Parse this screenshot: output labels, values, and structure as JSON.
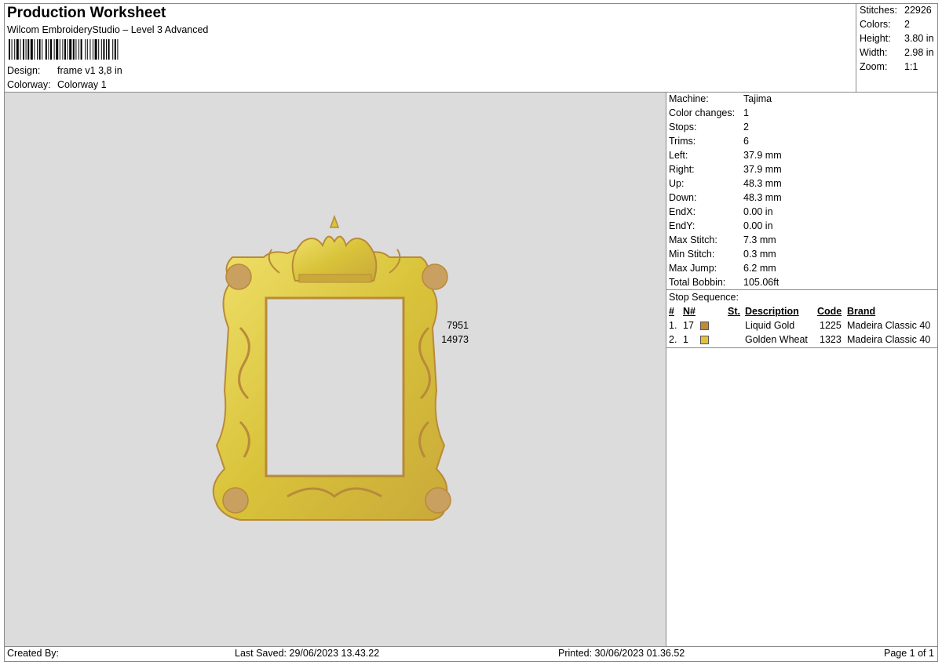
{
  "header": {
    "title": "Production Worksheet",
    "subtitle": "Wilcom EmbroideryStudio – Level 3 Advanced",
    "design_label": "Design:",
    "design_value": "frame v1 3,8 in",
    "colorway_label": "Colorway:",
    "colorway_value": "Colorway 1"
  },
  "summary": {
    "stitches_label": "Stitches:",
    "stitches_value": "22926",
    "colors_label": "Colors:",
    "colors_value": "2",
    "height_label": "Height:",
    "height_value": "3.80 in",
    "width_label": "Width:",
    "width_value": "2.98 in",
    "zoom_label": "Zoom:",
    "zoom_value": "1:1"
  },
  "info": [
    {
      "label": "Machine:",
      "value": "Tajima"
    },
    {
      "label": "Color changes:",
      "value": "1"
    },
    {
      "label": "Stops:",
      "value": "2"
    },
    {
      "label": "Trims:",
      "value": "6"
    },
    {
      "label": "Left:",
      "value": "37.9 mm"
    },
    {
      "label": "Right:",
      "value": "37.9 mm"
    },
    {
      "label": "Up:",
      "value": "48.3 mm"
    },
    {
      "label": "Down:",
      "value": "48.3 mm"
    },
    {
      "label": "EndX:",
      "value": "0.00 in"
    },
    {
      "label": "EndY:",
      "value": "0.00 in"
    },
    {
      "label": "Max Stitch:",
      "value": "7.3 mm"
    },
    {
      "label": "Min Stitch:",
      "value": "0.3 mm"
    },
    {
      "label": "Max Jump:",
      "value": "6.2 mm"
    },
    {
      "label": "Total Bobbin:",
      "value": "105.06ft"
    }
  ],
  "stop_sequence": {
    "title": "Stop Sequence:",
    "headers": {
      "num": "#",
      "n": "N#",
      "st": "St.",
      "desc": "Description",
      "code": "Code",
      "brand": "Brand"
    },
    "rows": [
      {
        "num": "1.",
        "n": "17",
        "color": "#c08a38",
        "st": "7951",
        "desc": "Liquid Gold",
        "code": "1225",
        "brand": "Madeira Classic 40"
      },
      {
        "num": "2.",
        "n": "1",
        "color": "#e2c23a",
        "st": "14973",
        "desc": "Golden Wheat",
        "code": "1323",
        "brand": "Madeira Classic 40"
      }
    ]
  },
  "footer": {
    "created_by": "Created By:",
    "last_saved": "Last Saved: 29/06/2023 13.43.22",
    "printed": "Printed: 30/06/2023 01.36.52",
    "page": "Page 1 of 1"
  },
  "colors": {
    "canvas_bg": "#dcdcdc",
    "gold_light": "#e6d64a",
    "gold_dark": "#b98a3a"
  }
}
